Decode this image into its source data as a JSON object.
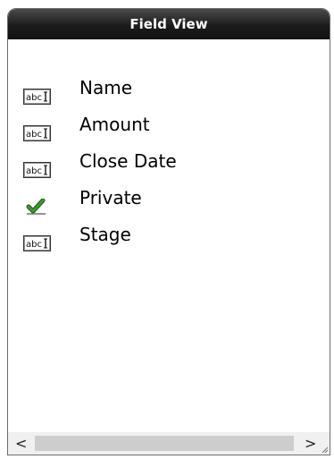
{
  "panel": {
    "title": "Field View"
  },
  "fields": [
    {
      "label": "Name",
      "icon": "text-field-icon",
      "icon_text": "abc"
    },
    {
      "label": "Amount",
      "icon": "text-field-icon",
      "icon_text": "abc"
    },
    {
      "label": "Close Date",
      "icon": "text-field-icon",
      "icon_text": "abc"
    },
    {
      "label": "Private",
      "icon": "checkmark-icon"
    },
    {
      "label": "Stage",
      "icon": "text-field-icon",
      "icon_text": "abc"
    }
  ],
  "scrollbar": {
    "left_arrow": "<",
    "right_arrow": ">"
  },
  "colors": {
    "header_bg": "#1c1c1c",
    "checkmark": "#3a9a2c"
  }
}
